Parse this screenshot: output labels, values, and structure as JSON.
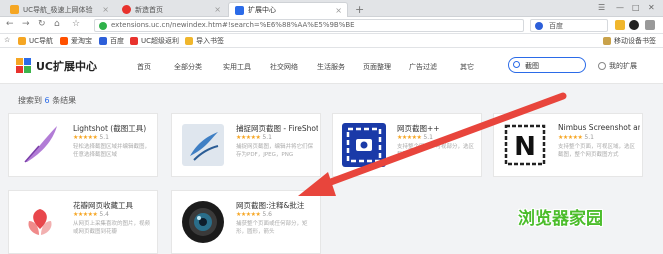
{
  "browser": {
    "tabs": [
      {
        "label": "UC导航_极速上网体验",
        "color": "#f5a623"
      },
      {
        "label": "新造首页",
        "color": "#e8322d"
      },
      {
        "label": "扩展中心",
        "color": "#2b6be8"
      }
    ],
    "new_tab": "+",
    "url": "extensions.uc.cn/newindex.htm#!search=%E6%88%AA%E5%9B%BE",
    "search_engine": "百度",
    "bookmarks": [
      "UC导航",
      "爱淘宝",
      "百度",
      "UC超级返利",
      "导入书签"
    ],
    "mobile_bookmarks": "移动设备书签"
  },
  "site": {
    "logo_text": "UC扩展中心",
    "nav": [
      "首页",
      "全部分类",
      "实用工具",
      "社交网络",
      "生活服务",
      "页面整理",
      "广告过滤",
      "其它"
    ],
    "search_value": "截图",
    "my_extensions": "我的扩展"
  },
  "results": {
    "prefix": "搜索到",
    "count": "6",
    "suffix": "条结果",
    "items": [
      {
        "name": "Lightshot (截图工具)",
        "stars": "★★★★★",
        "rating": "5.1",
        "desc": "轻松选择截图区域并编辑截图，任意选择截图区域"
      },
      {
        "name": "捕捉网页截图 - FireShot的",
        "stars": "★★★★★",
        "rating": "5.1",
        "desc": "捕捉网页截图，编辑并将它们保存为PDF，JPEG，PNG"
      },
      {
        "name": "网页截图++",
        "stars": "★★★★★",
        "rating": "5.1",
        "desc": "支持整个网页，可视部分，选区截图"
      },
      {
        "name": "Nimbus Screenshot and Sc...",
        "stars": "★★★★★",
        "rating": "5.1",
        "desc": "支持整个页面，可视区域，选区截图，整个网页截图方式"
      },
      {
        "name": "花瓣网页收藏工具",
        "stars": "★★★★★",
        "rating": "5.4",
        "desc": "从网页上采集喜欢的图片，视频或网页截图到花瓣"
      },
      {
        "name": "网页截图:注释&批注",
        "stars": "★★★★★",
        "rating": "5.6",
        "desc": "捕获整个页面或任何部分，矩形，圆形，箭头"
      }
    ]
  },
  "watermark": "浏览器家园",
  "colors": {
    "accent": "#2b6be8",
    "arrow": "#e8453c",
    "star": "#f6a623",
    "watermark": "#4bbd2b"
  }
}
